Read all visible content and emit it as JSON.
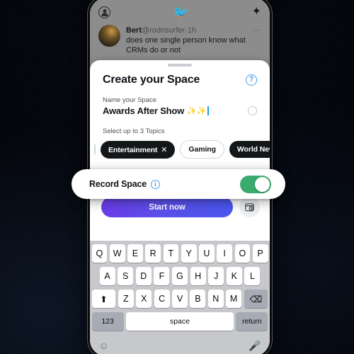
{
  "scene": {
    "description": "Twitter Spaces creation sheet on a phone with a highlighted Record Space toggle",
    "backdrop_color": "#04050a"
  },
  "feed": {
    "profile_icon": "account-circle-icon",
    "logo_icon": "twitter-bird-icon",
    "sparkle_icon": "sparkle-icon",
    "tweet": {
      "name": "Bert",
      "handle": "@rodrisurfer",
      "separator": " · ",
      "time": "1h",
      "more_icon": "more-dots-icon",
      "text": "does one single person know what CRMs do or not"
    }
  },
  "sheet": {
    "title": "Create your Space",
    "help_icon_label": "?",
    "name_field": {
      "label": "Name your Space",
      "value": "Awards After Show",
      "emoji": "✨✨",
      "status_circle": "empty-circle-indicator"
    },
    "topics": {
      "label": "Select up to 3 Topics",
      "chips": [
        {
          "label": "",
          "style": "partial",
          "removable": false
        },
        {
          "label": "Entertainment",
          "style": "selected",
          "removable": true,
          "remove_glyph": "✕"
        },
        {
          "label": "Gaming",
          "style": "unselected",
          "removable": false
        },
        {
          "label": "World News",
          "style": "selected",
          "removable": false
        }
      ]
    },
    "actions": {
      "start_label": "Start now",
      "start_gradient_from": "#6c3ce9",
      "start_gradient_to": "#4a56ef",
      "schedule_icon": "calendar-clock-icon"
    }
  },
  "record_card": {
    "label": "Record Space",
    "info_icon": "info-icon",
    "toggle": {
      "name": "record-space-toggle",
      "state": "on",
      "on_color": "#3aaa6e"
    }
  },
  "keyboard": {
    "row1": [
      "Q",
      "W",
      "E",
      "R",
      "T",
      "Y",
      "U",
      "I",
      "O",
      "P"
    ],
    "row2": [
      "A",
      "S",
      "D",
      "F",
      "G",
      "H",
      "J",
      "K",
      "L"
    ],
    "row3": {
      "shift": "⬆",
      "letters": [
        "Z",
        "X",
        "C",
        "V",
        "B",
        "N",
        "M"
      ],
      "backspace": "⌫"
    },
    "row4": {
      "numbers": "123",
      "space": "space",
      "return": "return"
    },
    "bottom": {
      "emoji_icon": "emoji-smiley-icon",
      "mic_icon": "microphone-icon"
    }
  }
}
